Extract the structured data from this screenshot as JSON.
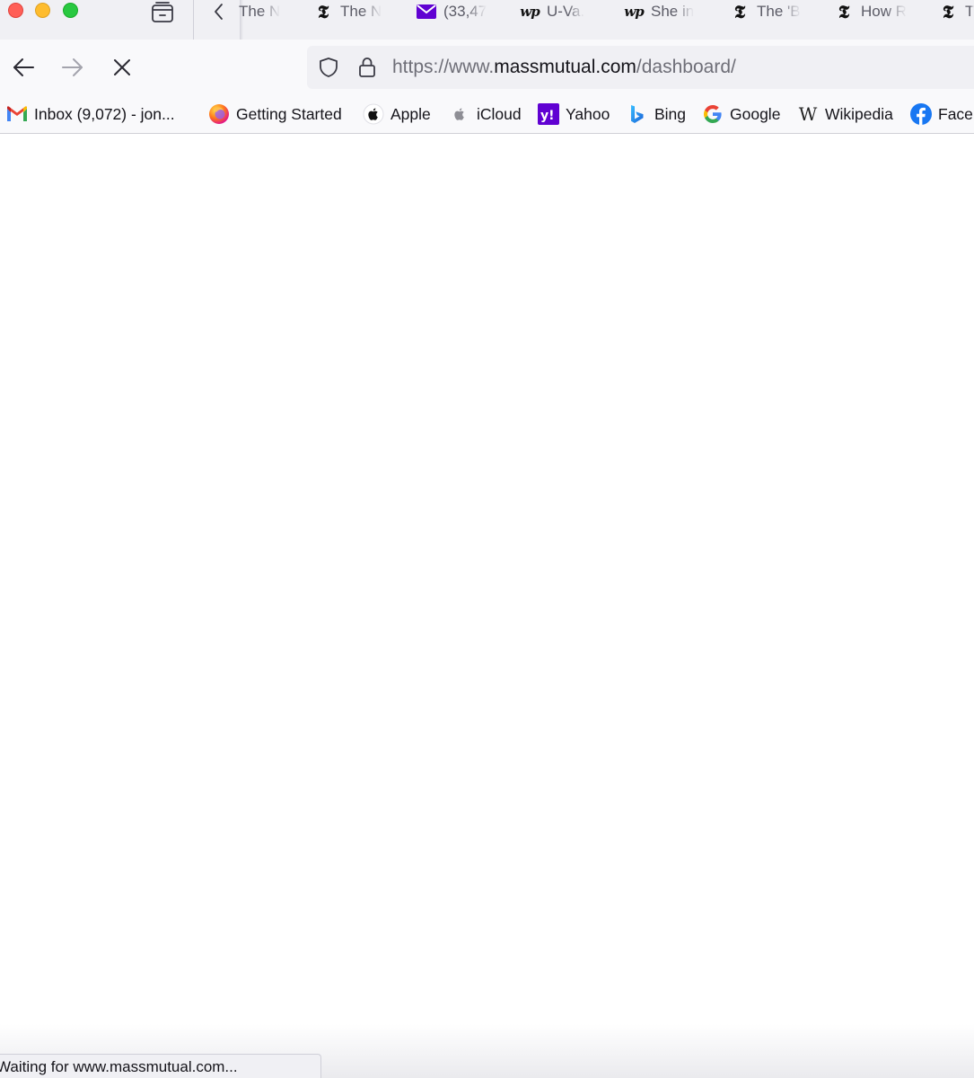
{
  "window": {
    "traffic_lights": {
      "close_color": "#ff5f57",
      "minimize_color": "#febc2e",
      "maximize_color": "#28c840"
    }
  },
  "tabs": [
    {
      "icon": "nyt-icon",
      "title": "The N"
    },
    {
      "icon": "nyt-icon",
      "title": "The N"
    },
    {
      "icon": "yahoo-mail-icon",
      "title": "(33,47"
    },
    {
      "icon": "washington-post-icon",
      "title": "U-Va."
    },
    {
      "icon": "washington-post-icon",
      "title": "She in"
    },
    {
      "icon": "nyt-icon",
      "title": "The 'B"
    },
    {
      "icon": "nyt-icon",
      "title": "How R"
    },
    {
      "icon": "nyt-icon",
      "title": "T"
    }
  ],
  "navbar": {
    "url": {
      "scheme": "https://www.",
      "host": "massmutual.com",
      "path": "/dashboard/"
    },
    "reload_state": "stop"
  },
  "bookmarks": [
    {
      "icon": "gmail-icon",
      "label": "Inbox (9,072) - jon..."
    },
    {
      "icon": "firefox-icon",
      "label": "Getting Started"
    },
    {
      "icon": "apple-icon",
      "label": "Apple"
    },
    {
      "icon": "apple-icon",
      "label": "iCloud"
    },
    {
      "icon": "yahoo-icon",
      "label": "Yahoo"
    },
    {
      "icon": "bing-icon",
      "label": "Bing"
    },
    {
      "icon": "google-icon",
      "label": "Google"
    },
    {
      "icon": "wikipedia-icon",
      "label": "Wikipedia"
    },
    {
      "icon": "facebook-icon",
      "label": "Face"
    }
  ],
  "status": {
    "text": "Waiting for www.massmutual.com..."
  },
  "colors": {
    "accent_yahoo": "#6001d2",
    "accent_facebook": "#1877f2",
    "accent_bing": "#2f8bf0"
  }
}
